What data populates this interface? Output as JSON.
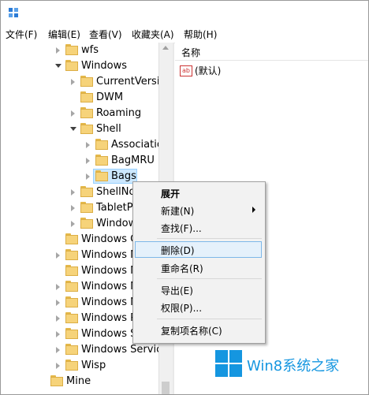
{
  "menubar": {
    "items": [
      "文件(F)",
      "编辑(E)",
      "查看(V)",
      "收藏夹(A)",
      "帮助(H)"
    ]
  },
  "tree": {
    "rows": [
      {
        "label": "wfs",
        "expander": "collapsed"
      },
      {
        "label": "Windows",
        "expander": "expanded"
      },
      {
        "label": "CurrentVersio",
        "expander": "collapsed"
      },
      {
        "label": "DWM",
        "expander": "none"
      },
      {
        "label": "Roaming",
        "expander": "collapsed"
      },
      {
        "label": "Shell",
        "expander": "expanded"
      },
      {
        "label": "Associatic",
        "expander": "collapsed"
      },
      {
        "label": "BagMRU",
        "expander": "collapsed"
      },
      {
        "label": "Bags",
        "expander": "collapsed",
        "selected": true
      },
      {
        "label": "ShellNo",
        "expander": "collapsed"
      },
      {
        "label": "TabletP",
        "expander": "collapsed"
      },
      {
        "label": "Window",
        "expander": "collapsed"
      },
      {
        "label": "Windows C",
        "expander": "none"
      },
      {
        "label": "Windows M",
        "expander": "collapsed"
      },
      {
        "label": "Windows M",
        "expander": "none"
      },
      {
        "label": "Windows M",
        "expander": "collapsed"
      },
      {
        "label": "Windows N",
        "expander": "collapsed"
      },
      {
        "label": "Windows P",
        "expander": "collapsed"
      },
      {
        "label": "Windows S",
        "expander": "collapsed"
      },
      {
        "label": "Windows Service",
        "expander": "collapsed"
      },
      {
        "label": "Wisp",
        "expander": "collapsed"
      },
      {
        "label": "Mine",
        "expander": "none"
      }
    ]
  },
  "right_pane": {
    "column_name": "名称",
    "value_icon_text": "ab",
    "value_name": "(默认)"
  },
  "context_menu": {
    "items": [
      {
        "label": "展开",
        "bold": true
      },
      {
        "label": "新建(N)",
        "submenu": true
      },
      {
        "label": "查找(F)..."
      },
      {
        "label": "删除(D)",
        "hover": true
      },
      {
        "label": "重命名(R)"
      },
      {
        "label": "导出(E)"
      },
      {
        "label": "权限(P)..."
      },
      {
        "label": "复制项名称(C)"
      }
    ]
  },
  "watermark": {
    "text": "Win8系统之家",
    "color": "#1596e0"
  }
}
